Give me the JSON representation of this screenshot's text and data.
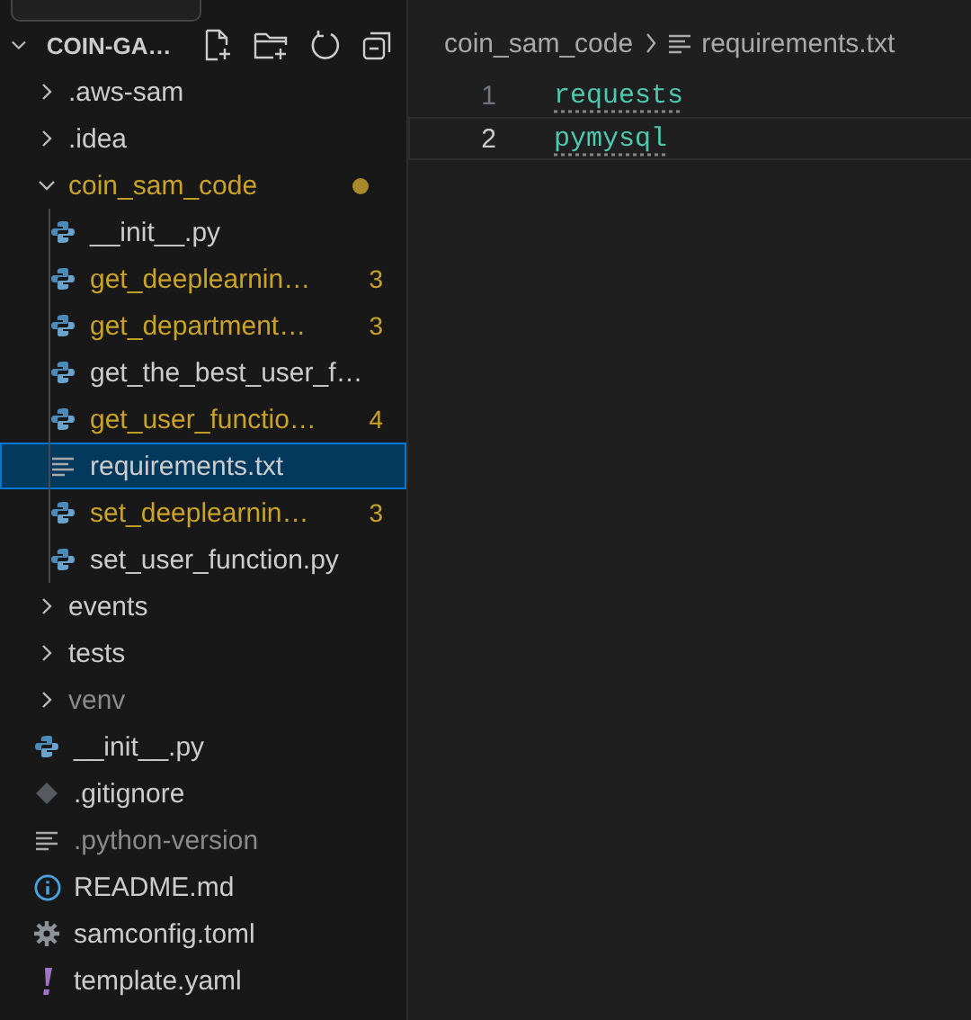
{
  "explorer": {
    "title": "COIN-GA…",
    "expanded": true,
    "tree": [
      {
        "kind": "folder",
        "name": ".aws-sam",
        "expanded": false,
        "modified": false,
        "dimmed": false
      },
      {
        "kind": "folder",
        "name": ".idea",
        "expanded": false,
        "modified": false,
        "dimmed": false
      },
      {
        "kind": "folder",
        "name": "coin_sam_code",
        "expanded": true,
        "modified": true,
        "dimmed": false,
        "children": [
          {
            "kind": "python",
            "name": "__init__.py",
            "modified": false,
            "dimmed": false,
            "selected": false
          },
          {
            "kind": "python",
            "name": "get_deeplearnin…",
            "modified": true,
            "dimmed": false,
            "badge": "3",
            "selected": false
          },
          {
            "kind": "python",
            "name": "get_department…",
            "modified": true,
            "dimmed": false,
            "badge": "3",
            "selected": false
          },
          {
            "kind": "python",
            "name": "get_the_best_user_f…",
            "modified": false,
            "dimmed": false,
            "selected": false
          },
          {
            "kind": "python",
            "name": "get_user_functio…",
            "modified": true,
            "dimmed": false,
            "badge": "4",
            "selected": false
          },
          {
            "kind": "text",
            "name": "requirements.txt",
            "modified": false,
            "dimmed": false,
            "selected": true
          },
          {
            "kind": "python",
            "name": "set_deeplearnin…",
            "modified": true,
            "dimmed": false,
            "badge": "3",
            "selected": false
          },
          {
            "kind": "python",
            "name": "set_user_function.py",
            "modified": false,
            "dimmed": false,
            "selected": false
          }
        ]
      },
      {
        "kind": "folder",
        "name": "events",
        "expanded": false,
        "modified": false,
        "dimmed": false
      },
      {
        "kind": "folder",
        "name": "tests",
        "expanded": false,
        "modified": false,
        "dimmed": false
      },
      {
        "kind": "folder",
        "name": "venv",
        "expanded": false,
        "modified": false,
        "dimmed": true
      },
      {
        "kind": "python",
        "name": "__init__.py",
        "modified": false,
        "dimmed": false,
        "selected": false
      },
      {
        "kind": "git",
        "name": ".gitignore",
        "modified": false,
        "dimmed": false,
        "selected": false
      },
      {
        "kind": "text",
        "name": ".python-version",
        "modified": false,
        "dimmed": true,
        "selected": false
      },
      {
        "kind": "info",
        "name": "README.md",
        "modified": false,
        "dimmed": false,
        "selected": false
      },
      {
        "kind": "gear",
        "name": "samconfig.toml",
        "modified": false,
        "dimmed": false,
        "selected": false
      },
      {
        "kind": "yaml",
        "name": "template.yaml",
        "modified": false,
        "dimmed": false,
        "selected": false
      }
    ]
  },
  "editor": {
    "breadcrumb": [
      "coin_sam_code",
      "requirements.txt"
    ],
    "lines": [
      {
        "number": "1",
        "text": "requests",
        "current": false
      },
      {
        "number": "2",
        "text": "pymysql",
        "current": true
      }
    ]
  }
}
